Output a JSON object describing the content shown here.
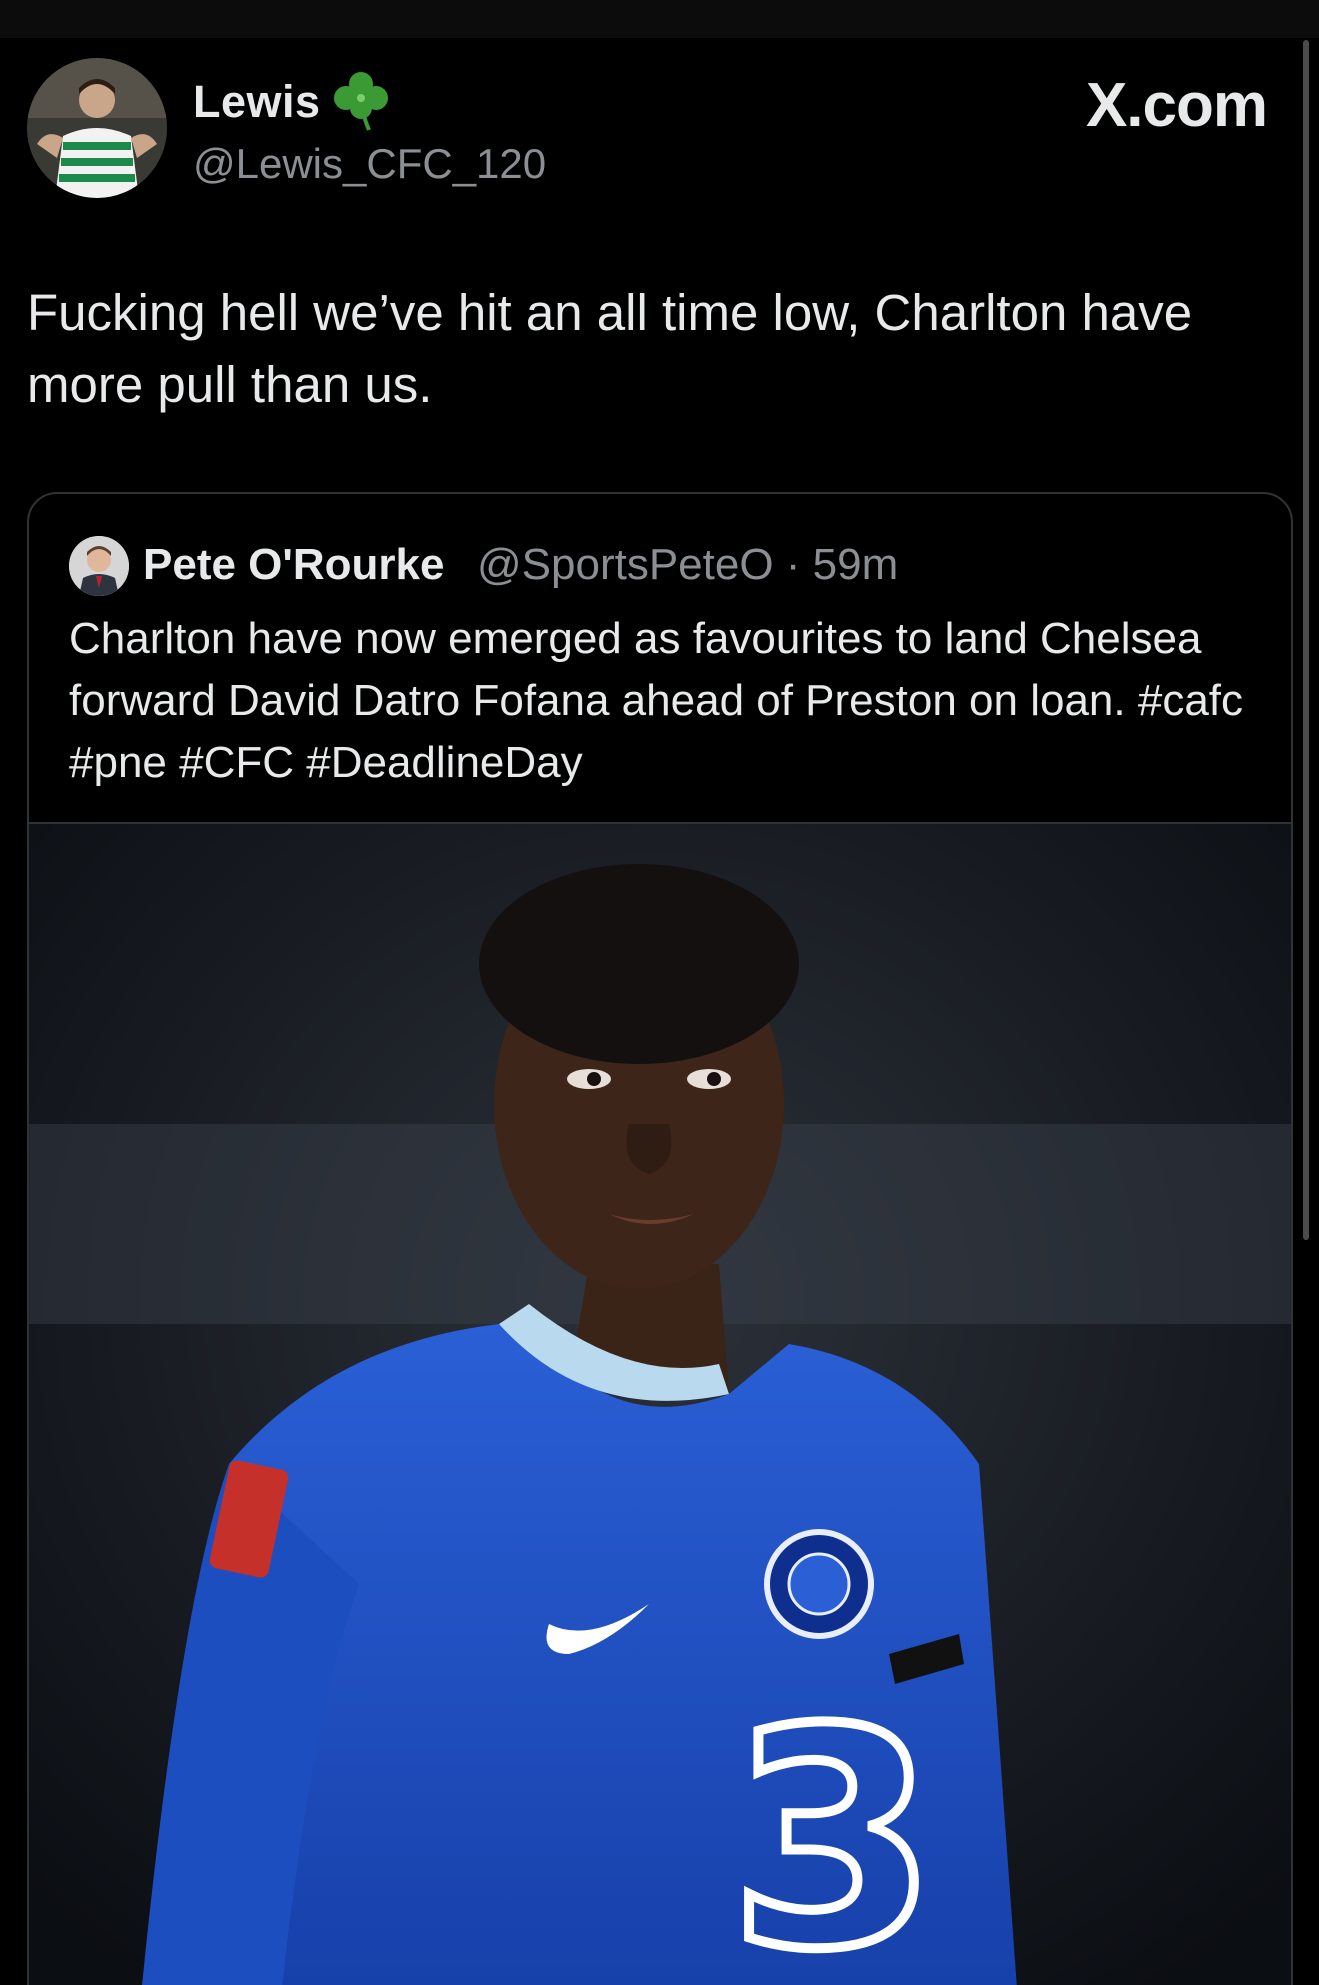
{
  "author": {
    "display_name": "Lewis",
    "handle": "@Lewis_CFC_120",
    "badge_icon": "shamrock-icon"
  },
  "brand": "X.com",
  "tweet": {
    "text": "Fucking hell we’ve hit an all time low, Charlton have more pull than us."
  },
  "quoted": {
    "display_name": "Pete O'Rourke",
    "meta": "@SportsPeteO · 59m",
    "text": "Charlton have now emerged as favourites to land Chelsea forward David Datro Fofana ahead of Preston on loan. #cafc #pne #CFC #DeadlineDay",
    "media_icon": "player-photo"
  },
  "colors": {
    "background": "#000000",
    "text": "#e7e9ea",
    "secondary": "#8b8f93",
    "border": "#2f3336",
    "chelsea_blue": "#1f4fc4"
  }
}
